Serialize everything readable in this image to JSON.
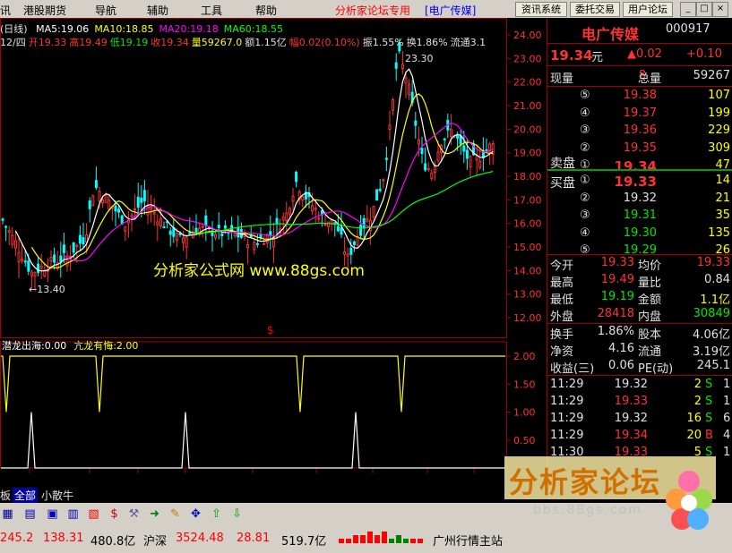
{
  "menubar": {
    "items": [
      "讯",
      "港股期货",
      "导航",
      "辅助",
      "工具",
      "帮助"
    ],
    "title": "分析家论坛专用",
    "subtitle": "[电广传媒]",
    "buttons": [
      "资讯系统",
      "委托交易",
      "用户论坛"
    ],
    "window_buttons": [
      "_",
      "□",
      "×"
    ]
  },
  "chart": {
    "period_label": "(日线)",
    "ma_legend": [
      {
        "label": "MA5:19.06",
        "color": "#ffffff"
      },
      {
        "label": "MA10:18.85",
        "color": "#ffff00"
      },
      {
        "label": "MA20:19.18",
        "color": "#ff00ff"
      },
      {
        "label": "MA60:18.55",
        "color": "#00ff00"
      }
    ],
    "info_line": [
      {
        "text": "12/四",
        "color": "#e0e0e0"
      },
      {
        "text": "开19.33",
        "color": "#ff3232"
      },
      {
        "text": "高19.49",
        "color": "#ff3232"
      },
      {
        "text": "低19.19",
        "color": "#00e600"
      },
      {
        "text": "收19.34",
        "color": "#ff3232"
      },
      {
        "text": "量59267.0",
        "color": "#ffff00"
      },
      {
        "text": "额1.15亿",
        "color": "#e0e0e0"
      },
      {
        "text": "幅0.02(0.10%)",
        "color": "#ff3232"
      },
      {
        "text": "振1.55%",
        "color": "#e0e0e0"
      },
      {
        "text": "换1.86%",
        "color": "#e0e0e0"
      },
      {
        "text": "流通3.1",
        "color": "#e0e0e0"
      }
    ],
    "high_label": "23.30",
    "low_label": "←13.40",
    "watermark_text": "分析家公式网  www.88gs.com",
    "y_ticks": [
      "24.00",
      "23.00",
      "22.00",
      "21.00",
      "20.00",
      "19.00",
      "18.00",
      "17.00",
      "16.00",
      "15.00",
      "14.00",
      "13.00",
      "12.00"
    ],
    "indicator_legend": [
      {
        "label": "潜龙出海:0.00",
        "color": "#ffffff"
      },
      {
        "label": "亢龙有悔:2.00",
        "color": "#ffff00"
      }
    ],
    "ind_ticks": [
      "2.00",
      "1.50",
      "1.00",
      "0.50"
    ],
    "month_labels": [
      "3",
      "4",
      "5",
      "6",
      "7",
      "8",
      "9",
      "10",
      "11"
    ],
    "dollar_mark": "$"
  },
  "chart_data": {
    "type": "candlestick",
    "ylim": [
      12,
      24.5
    ],
    "indicator_ylim": [
      0,
      2.2
    ],
    "ma_last": {
      "MA5": 19.06,
      "MA10": 18.85,
      "MA20": 19.18,
      "MA60": 18.55
    },
    "high": 23.3,
    "low": 13.4
  },
  "panel": {
    "stock_name": "电广传媒",
    "stock_code": "000917",
    "price": "19.34",
    "price_unit": "元",
    "change": "▲0.02",
    "change_pct": "+0.10",
    "volume_label": "现量",
    "volume_value": "8",
    "total_label": "总量",
    "total_value": "59267",
    "asks": [
      {
        "idx": "⑤",
        "price": "19.38",
        "vol": "107"
      },
      {
        "idx": "④",
        "price": "19.37",
        "vol": "199"
      },
      {
        "idx": "③",
        "price": "19.36",
        "vol": "229"
      },
      {
        "idx": "②",
        "price": "19.35",
        "vol": "309"
      },
      {
        "idx": "①",
        "price": "19.34",
        "vol": "47"
      }
    ],
    "sell_label": "卖盘",
    "buy_label": "买盘",
    "bids": [
      {
        "idx": "①",
        "price": "19.33",
        "vol": "14"
      },
      {
        "idx": "②",
        "price": "19.32",
        "vol": "21"
      },
      {
        "idx": "③",
        "price": "19.31",
        "vol": "35"
      },
      {
        "idx": "④",
        "price": "19.30",
        "vol": "135"
      },
      {
        "idx": "⑤",
        "price": "19.29",
        "vol": "26"
      }
    ],
    "stats": [
      {
        "l1": "今开",
        "v1": "19.33",
        "c1": "#ff3232",
        "l2": "均价",
        "v2": "19.33",
        "c2": "#ff3232"
      },
      {
        "l1": "最高",
        "v1": "19.49",
        "c1": "#ff3232",
        "l2": "量比",
        "v2": "0.84",
        "c2": "#e0e0e0"
      },
      {
        "l1": "最低",
        "v1": "19.19",
        "c1": "#00e600",
        "l2": "金额",
        "v2": "1.1亿",
        "c2": "#ffff00"
      },
      {
        "l1": "外盘",
        "v1": "28418",
        "c1": "#ff3232",
        "l2": "内盘",
        "v2": "30849",
        "c2": "#00e600"
      }
    ],
    "stats2": [
      {
        "l1": "换手",
        "v1": "1.86%",
        "l2": "股本",
        "v2": "4.06亿"
      },
      {
        "l1": "净资",
        "v1": "4.16",
        "l2": "流通",
        "v2": "3.19亿"
      },
      {
        "l1": "收益(三)",
        "v1": "0.06",
        "l2": "PE(动)",
        "v2": "245.1"
      }
    ],
    "ticks": [
      {
        "time": "11:29",
        "price": "19.32",
        "pc": "#e0e0e0",
        "vol": "2",
        "side": "S",
        "n": "1"
      },
      {
        "time": "11:29",
        "price": "19.33",
        "pc": "#ff3232",
        "vol": "2",
        "side": "S",
        "n": "1"
      },
      {
        "time": "11:29",
        "price": "19.32",
        "pc": "#e0e0e0",
        "vol": "16",
        "side": "S",
        "n": "6"
      },
      {
        "time": "11:29",
        "price": "19.34",
        "pc": "#ff3232",
        "vol": "20",
        "side": "B",
        "n": "4"
      },
      {
        "time": "11:30",
        "price": "19.33",
        "pc": "#ff3232",
        "vol": "5",
        "side": "S",
        "n": "1"
      }
    ]
  },
  "tabs": [
    "板",
    "全部",
    "小散牛"
  ],
  "statusbar": {
    "v1": "245.2",
    "v2": "138.31",
    "v3": "480.8亿",
    "index_name": "沪深",
    "index_value": "3524.48",
    "v5": "28.81",
    "v6": "519.7亿",
    "server": "广州行情主站"
  },
  "forum_watermark": {
    "title": "分析家论坛",
    "url": "bbs.88gs.com"
  }
}
